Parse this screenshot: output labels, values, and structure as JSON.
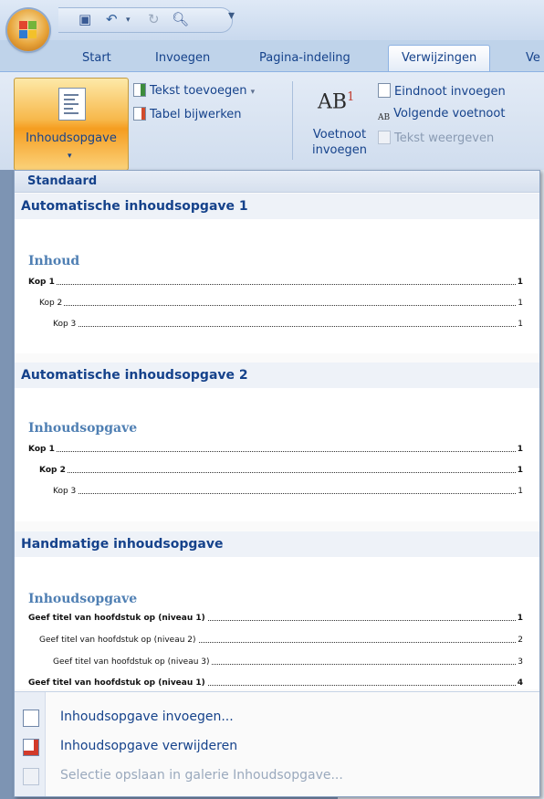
{
  "tabs": [
    "Start",
    "Invoegen",
    "Pagina-indeling",
    "Verwijzingen",
    "Ve"
  ],
  "ribbon": {
    "big_button_label": "Inhoudsopgave",
    "big_button_arrow": "▾",
    "add_text": "Tekst toevoegen",
    "add_text_arrow": "▾",
    "update_table": "Tabel bijwerken",
    "footnote_icon": "AB",
    "footnote_sup": "1",
    "footnote_line1": "Voetnoot",
    "footnote_line2": "invoegen",
    "insert_endnote": "Eindnoot invoegen",
    "next_footnote": "Volgende voetnoot",
    "show_text": "Tekst weergeven"
  },
  "gallery": {
    "header": "Standaard",
    "sections": [
      {
        "title": "Automatische inhoudsopgave 1",
        "heading": "Inhoud",
        "entries": [
          {
            "text": "Kop 1",
            "page": "1"
          },
          {
            "text": "Kop 2",
            "page": "1"
          },
          {
            "text": "Kop 3",
            "page": "1"
          }
        ]
      },
      {
        "title": "Automatische inhoudsopgave 2",
        "heading": "Inhoudsopgave",
        "entries": [
          {
            "text": "Kop 1",
            "page": "1"
          },
          {
            "text": "Kop 2",
            "page": "1"
          },
          {
            "text": "Kop 3",
            "page": "1"
          }
        ]
      },
      {
        "title": "Handmatige inhoudsopgave",
        "heading": "Inhoudsopgave",
        "entries": [
          {
            "text": "Geef titel van hoofdstuk op (niveau 1)",
            "page": "1"
          },
          {
            "text": "Geef titel van hoofdstuk op (niveau 2)",
            "page": "2"
          },
          {
            "text": "Geef titel van hoofdstuk op (niveau 3)",
            "page": "3"
          },
          {
            "text": "Geef titel van hoofdstuk op (niveau 1)",
            "page": "4"
          }
        ]
      }
    ],
    "menu": [
      {
        "label": "Inhoudsopgave invoegen...",
        "enabled": true
      },
      {
        "label": "Inhoudsopgave verwijderen",
        "enabled": true
      },
      {
        "label": "Selectie opslaan in galerie Inhoudsopgave...",
        "enabled": false
      }
    ]
  },
  "colors": {
    "accent": "#15428b",
    "heading": "#4f7fb3",
    "active_button": "#f7b84b"
  }
}
